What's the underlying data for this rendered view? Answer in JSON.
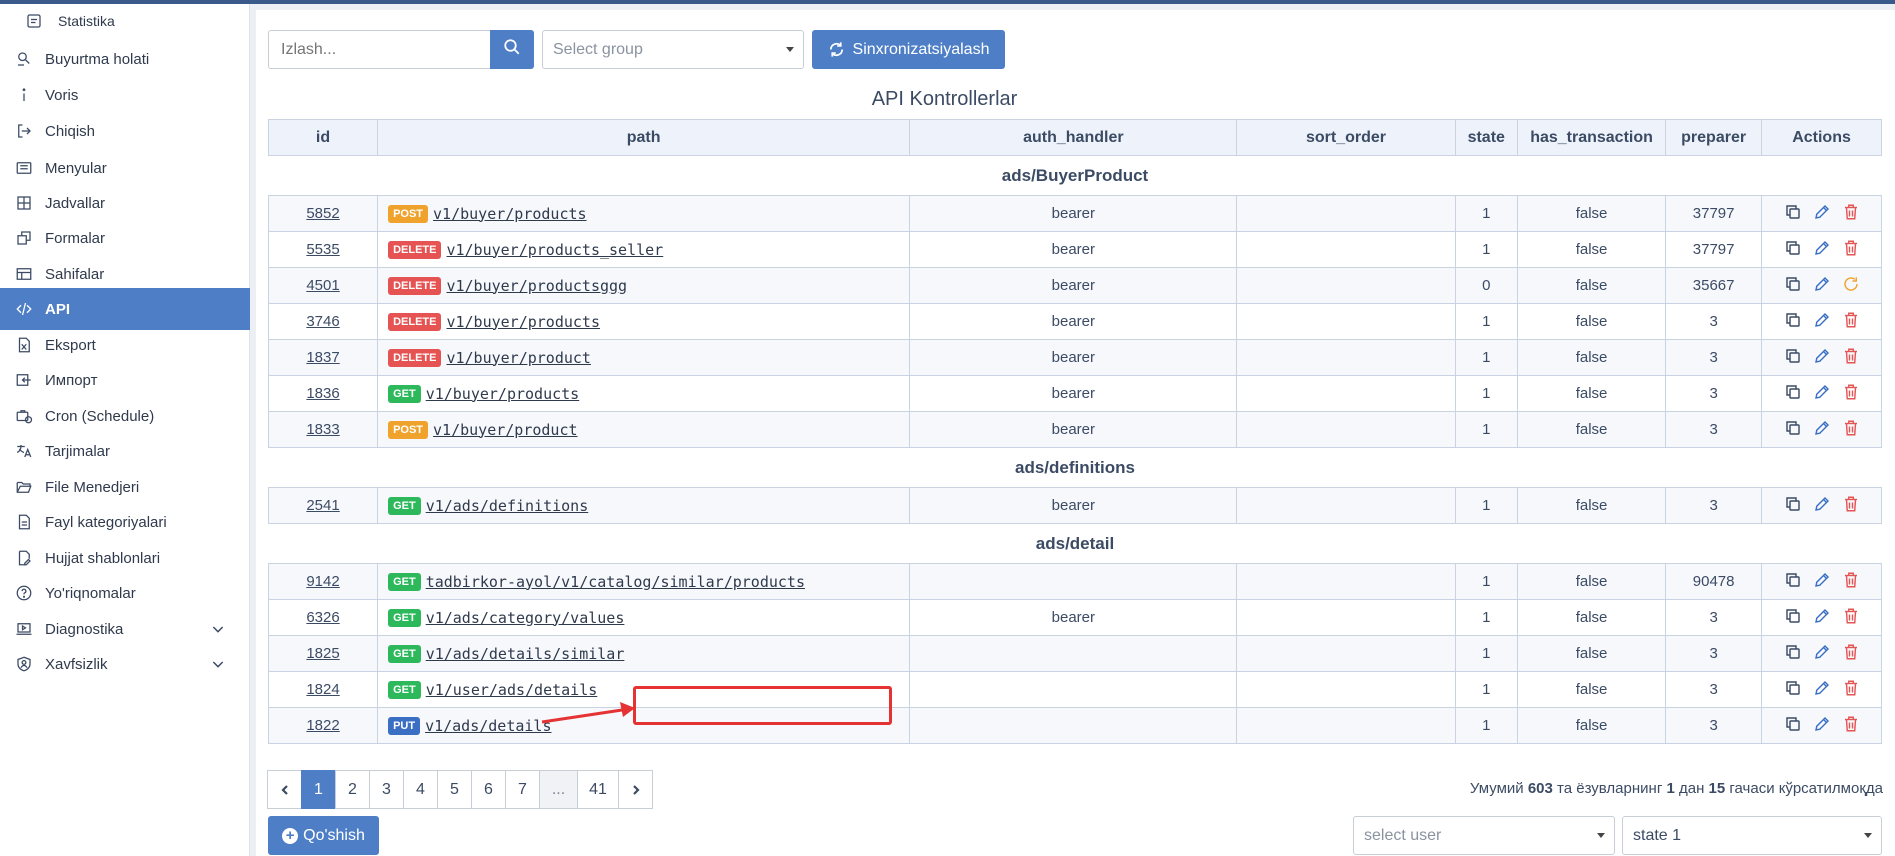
{
  "sidebar": {
    "items": [
      {
        "label": "Statistika",
        "icon": "chart-icon"
      },
      {
        "label": "Buyurtma holati",
        "icon": "search-list-icon"
      },
      {
        "label": "Voris",
        "icon": "info-icon"
      },
      {
        "label": "Chiqish",
        "icon": "logout-icon"
      },
      {
        "label": "Menyular",
        "icon": "list-icon"
      },
      {
        "label": "Jadvallar",
        "icon": "grid-icon"
      },
      {
        "label": "Formalar",
        "icon": "window-restore-icon"
      },
      {
        "label": "Sahifalar",
        "icon": "table-icon"
      },
      {
        "label": "API",
        "icon": "code-icon"
      },
      {
        "label": "Eksport",
        "icon": "excel-file-icon"
      },
      {
        "label": "Импорт",
        "icon": "import-icon"
      },
      {
        "label": "Cron (Schedule)",
        "icon": "briefcase-clock-icon"
      },
      {
        "label": "Tarjimalar",
        "icon": "translate-icon"
      },
      {
        "label": "File Menedjeri",
        "icon": "folder-open-icon"
      },
      {
        "label": "Fayl kategoriyalari",
        "icon": "file-icon"
      },
      {
        "label": "Hujjat shablonlari",
        "icon": "file-signature-icon"
      },
      {
        "label": "Yo'riqnomalar",
        "icon": "question-circle-icon"
      },
      {
        "label": "Diagnostika",
        "icon": "laptop-icon"
      },
      {
        "label": "Xavfsizlik",
        "icon": "user-shield-icon"
      }
    ]
  },
  "toolbar": {
    "search_placeholder": "Izlash...",
    "group_placeholder": "Select group",
    "sync_label": "Sinxronizatsiyalash"
  },
  "page_title": "API Kontrollerlar",
  "table": {
    "headers": [
      "id",
      "path",
      "auth_handler",
      "sort_order",
      "state",
      "has_transaction",
      "preparer",
      "Actions"
    ],
    "groups": [
      {
        "name": "ads/BuyerProduct",
        "rows": [
          {
            "id": "5852",
            "method": "POST",
            "path": "v1/buyer/products",
            "auth": "bearer",
            "sort": "",
            "state": "1",
            "trans": "false",
            "preparer": "37797",
            "deleted": false
          },
          {
            "id": "5535",
            "method": "DELETE",
            "path": "v1/buyer/products_seller",
            "auth": "bearer",
            "sort": "",
            "state": "1",
            "trans": "false",
            "preparer": "37797",
            "deleted": false
          },
          {
            "id": "4501",
            "method": "DELETE",
            "path": "v1/buyer/productsggg",
            "auth": "bearer",
            "sort": "",
            "state": "0",
            "trans": "false",
            "preparer": "35667",
            "deleted": true
          },
          {
            "id": "3746",
            "method": "DELETE",
            "path": "v1/buyer/products",
            "auth": "bearer",
            "sort": "",
            "state": "1",
            "trans": "false",
            "preparer": "3",
            "deleted": false
          },
          {
            "id": "1837",
            "method": "DELETE",
            "path": "v1/buyer/product",
            "auth": "bearer",
            "sort": "",
            "state": "1",
            "trans": "false",
            "preparer": "3",
            "deleted": false
          },
          {
            "id": "1836",
            "method": "GET",
            "path": "v1/buyer/products",
            "auth": "bearer",
            "sort": "",
            "state": "1",
            "trans": "false",
            "preparer": "3",
            "deleted": false
          },
          {
            "id": "1833",
            "method": "POST",
            "path": "v1/buyer/product",
            "auth": "bearer",
            "sort": "",
            "state": "1",
            "trans": "false",
            "preparer": "3",
            "deleted": false
          }
        ]
      },
      {
        "name": "ads/definitions",
        "rows": [
          {
            "id": "2541",
            "method": "GET",
            "path": "v1/ads/definitions",
            "auth": "bearer",
            "sort": "",
            "state": "1",
            "trans": "false",
            "preparer": "3",
            "deleted": false
          }
        ]
      },
      {
        "name": "ads/detail",
        "rows": [
          {
            "id": "9142",
            "method": "GET",
            "path": "tadbirkor-ayol/v1/catalog/similar/products",
            "auth": "",
            "sort": "",
            "state": "1",
            "trans": "false",
            "preparer": "90478",
            "deleted": false
          },
          {
            "id": "6326",
            "method": "GET",
            "path": "v1/ads/category/values",
            "auth": "bearer",
            "sort": "",
            "state": "1",
            "trans": "false",
            "preparer": "3",
            "deleted": false
          },
          {
            "id": "1825",
            "method": "GET",
            "path": "v1/ads/details/similar",
            "auth": "",
            "sort": "",
            "state": "1",
            "trans": "false",
            "preparer": "3",
            "deleted": false
          },
          {
            "id": "1824",
            "method": "GET",
            "path": "v1/user/ads/details",
            "auth": "",
            "sort": "",
            "state": "1",
            "trans": "false",
            "preparer": "3",
            "deleted": false
          },
          {
            "id": "1822",
            "method": "PUT",
            "path": "v1/ads/details",
            "auth": "",
            "sort": "",
            "state": "1",
            "trans": "false",
            "preparer": "3",
            "deleted": false
          }
        ]
      }
    ]
  },
  "pagination": {
    "pages": [
      "1",
      "2",
      "3",
      "4",
      "5",
      "6",
      "7",
      "...",
      "41"
    ],
    "current": "1"
  },
  "summary": {
    "prefix": "Умумий",
    "total": "603",
    "mid1": "та ёзувларнинг",
    "from": "1",
    "mid2": "дан",
    "to": "15",
    "suffix": "гачаси кўрсатилмоқда"
  },
  "footer": {
    "add_label": "Qo'shish",
    "user_placeholder": "select user",
    "state_value": "state 1"
  },
  "colors": {
    "accent": "#4e7fc6",
    "post": "#f0a32c",
    "delete": "#e55353",
    "get": "#2eb85c",
    "put": "#3a6fc4",
    "highlight": "#e53333"
  }
}
